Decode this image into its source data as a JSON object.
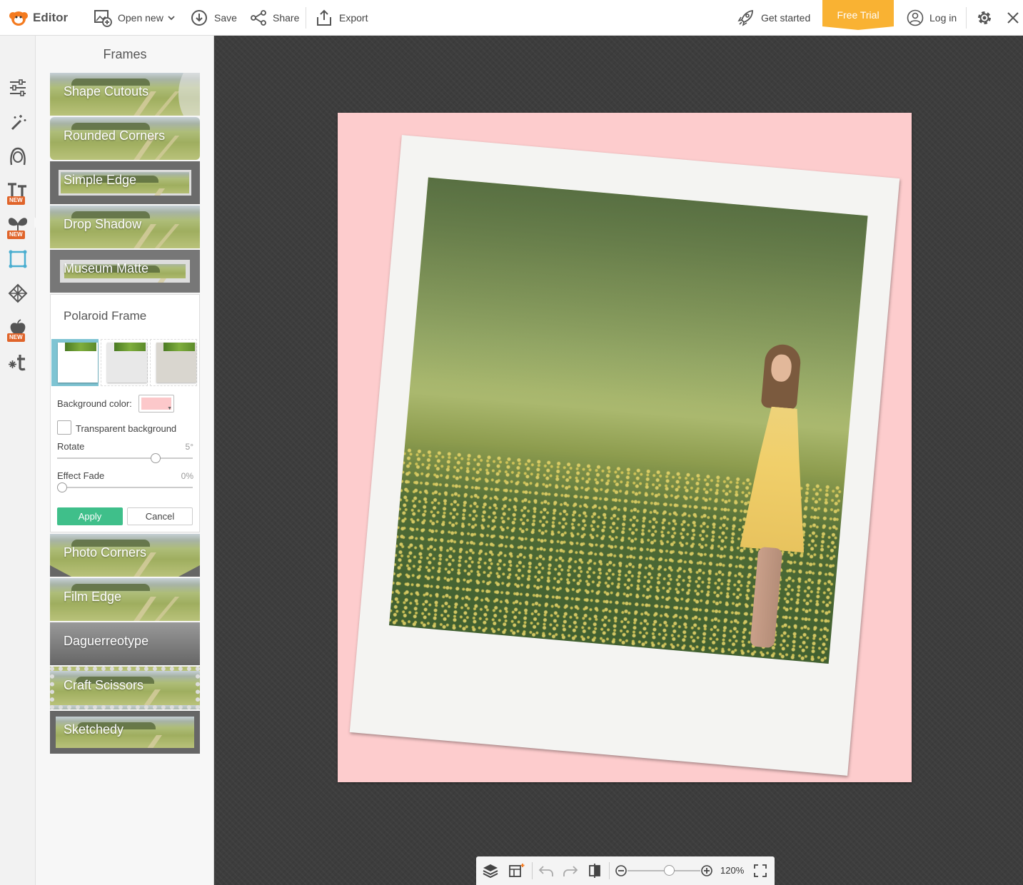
{
  "app": {
    "name": "Editor"
  },
  "toolbar": {
    "open_new": "Open new",
    "save": "Save",
    "share": "Share",
    "export": "Export",
    "get_started": "Get started",
    "free_trial": "Free Trial",
    "log_in": "Log in"
  },
  "rail": {
    "items": [
      {
        "icon": "sliders-icon"
      },
      {
        "icon": "magic-wand-icon"
      },
      {
        "icon": "face-icon"
      },
      {
        "icon": "text-icon",
        "badge": "NEW"
      },
      {
        "icon": "butterfly-icon",
        "badge": "NEW"
      },
      {
        "icon": "frame-icon",
        "active": true
      },
      {
        "icon": "texture-icon"
      },
      {
        "icon": "apple-icon",
        "badge": "NEW"
      },
      {
        "icon": "themes-icon"
      }
    ]
  },
  "panel": {
    "title": "Frames",
    "frames_top": [
      "Shape Cutouts",
      "Rounded Corners",
      "Simple Edge",
      "Drop Shadow",
      "Museum Matte"
    ],
    "frames_bottom": [
      "Photo Corners",
      "Film Edge",
      "Daguerreotype",
      "Craft Scissors",
      "Sketchedy"
    ]
  },
  "polaroid": {
    "title": "Polaroid Frame",
    "background_color_label": "Background color:",
    "background_color": "#fcc8ca",
    "transparent_label": "Transparent background",
    "transparent_checked": false,
    "rotate_label": "Rotate",
    "rotate_value": "5°",
    "effect_fade_label": "Effect Fade",
    "effect_fade_value": "0%",
    "apply": "Apply",
    "cancel": "Cancel"
  },
  "colors": {
    "accent_green": "#3fbf8a",
    "free_trial": "#f9b233",
    "canvas_bg": "#fdcccd",
    "selection_blue": "#7ec4d3"
  },
  "bottom_bar": {
    "zoom": "120%"
  }
}
